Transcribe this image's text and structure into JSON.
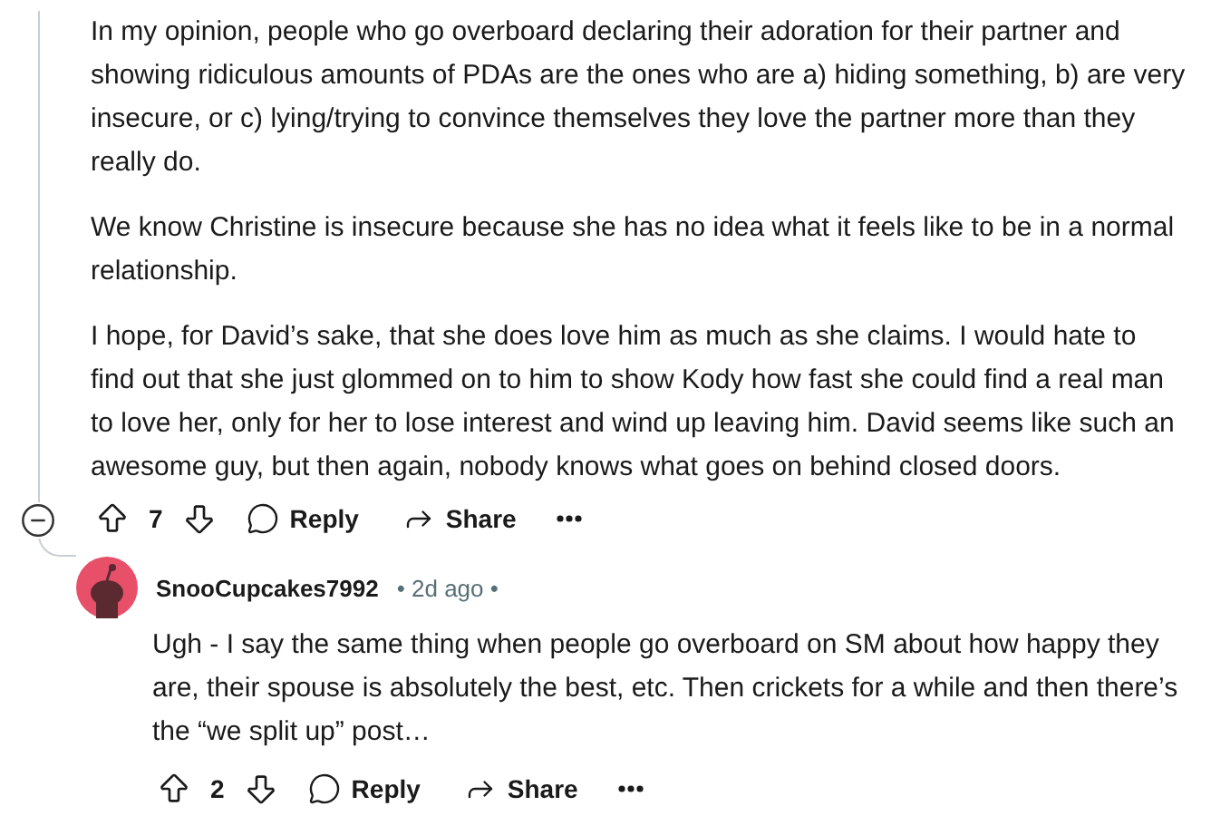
{
  "comment": {
    "expanded": true,
    "paragraphs": [
      "In my opinion, people who go overboard declaring their adoration for their partner and showing ridiculous amounts of PDAs are the ones who are a) hiding something, b) are very insecure, or c) lying/trying to convince themselves they love the partner more than they really do.",
      "We know Christine is insecure because she has no idea what it feels like to be in a normal relationship.",
      "I hope, for David’s sake, that she does love him as much as she claims. I would hate to find out that she just glommed on to him to show Kody how fast she could find a real man to love her, only for her to lose interest and wind up leaving him. David seems like such an awesome guy, but then again, nobody knows what goes on behind closed doors."
    ],
    "votes": "7",
    "actions": [
      {
        "kind": "reply",
        "label": "Reply"
      },
      {
        "kind": "share",
        "label": "Share"
      }
    ]
  },
  "reply": {
    "author": "SnooCupcakes7992",
    "meta": "• 2d ago •",
    "paragraphs": [
      "Ugh - I say the same thing when people go overboard on SM about how happy they are, their spouse is absolutely the best, etc. Then crickets for a while and then there’s the “we split up” post…"
    ],
    "votes": "2",
    "actions": [
      {
        "kind": "reply",
        "label": "Reply"
      },
      {
        "kind": "share",
        "label": "Share"
      }
    ]
  }
}
